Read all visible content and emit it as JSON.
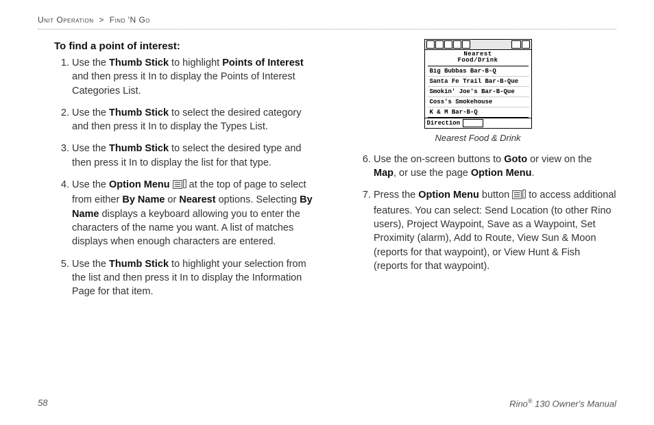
{
  "breadcrumb": {
    "section": "Unit Operation",
    "sep": ">",
    "page": "Find 'N Go"
  },
  "heading": "To find a point of interest:",
  "steps_left": [
    {
      "pre": "Use the ",
      "b1": "Thumb Stick",
      "mid1": " to highlight ",
      "b2": "Points of Interest",
      "post": " and then press it In to display the Points of Interest Categories List."
    },
    {
      "pre": "Use the ",
      "b1": "Thumb Stick",
      "post": " to select the desired category and then press it In to display the Types List."
    },
    {
      "pre": "Use the ",
      "b1": "Thumb Stick",
      "post": " to select the desired type and then press it In to display the list for that type."
    },
    {
      "pre": "Use the ",
      "b1": "Option Menu",
      "icon": true,
      "mid1": " at the top of page to select from either ",
      "b2": "By Name",
      "mid2": " or ",
      "b3": "Nearest",
      "mid3": " options. Selecting ",
      "b4": "By Name",
      "post": " displays a keyboard allowing you to enter the characters of the name you want. A list of matches displays when enough characters are entered."
    },
    {
      "pre": "Use the ",
      "b1": "Thumb Stick",
      "post": " to highlight your selection from the list and then press it In to display the Information Page for that item."
    }
  ],
  "steps_right": [
    {
      "pre": "Use the on-screen buttons to ",
      "b1": "Goto",
      "mid1": " or view on the ",
      "b2": "Map",
      "mid2": ", or use the page ",
      "b3": "Option Menu",
      "post": "."
    },
    {
      "pre": "Press the ",
      "b1": "Option Menu",
      "mid1": " button ",
      "icon": true,
      "post": " to access additional features. You can select: Send Location (to other Rino users), Project Waypoint, Save as a Waypoint, Set Proximity (alarm), Add to Route, View Sun & Moon (reports for that waypoint), or View Hunt & Fish (reports for that waypoint)."
    }
  ],
  "device": {
    "title_l1": "Nearest",
    "title_l2": "Food/Drink",
    "list": [
      "Big Bubbas Bar-B-Q",
      "Santa Fe Trail Bar-B-Que",
      "Smokin' Joe's Bar-B-Que",
      "Coss's Smokehouse",
      "K & M Bar-B-Q"
    ],
    "foot_label": "Direction"
  },
  "caption": "Nearest Food & Drink",
  "footer": {
    "page_no": "58",
    "product": "Rino",
    "product_suffix": " 130 Owner's Manual"
  }
}
